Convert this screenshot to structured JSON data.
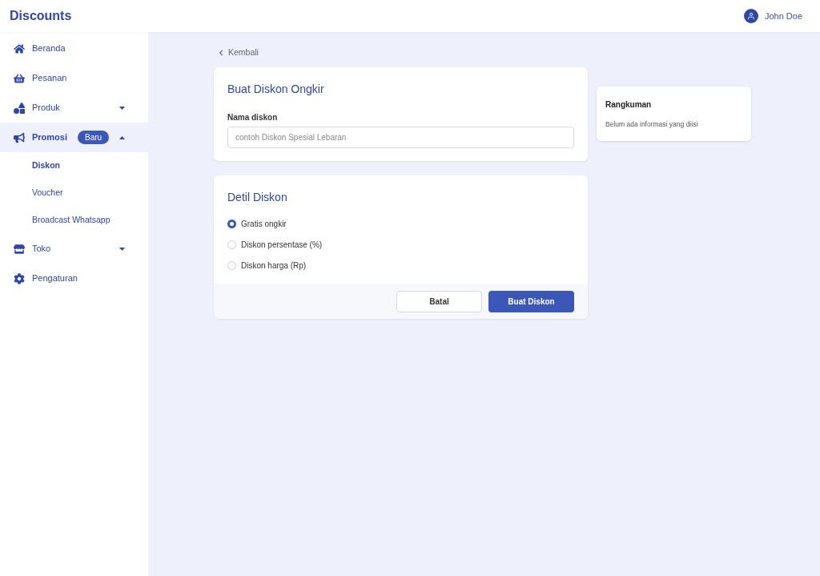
{
  "app": {
    "title": "Discounts"
  },
  "user": {
    "name": "John Doe"
  },
  "sidebar": {
    "items": [
      {
        "label": "Beranda",
        "selected": false
      },
      {
        "label": "Pesanan",
        "selected": false
      },
      {
        "label": "Produk",
        "selected": false,
        "expanded": false
      },
      {
        "label": "Promosi",
        "badge": "Baru",
        "selected": true,
        "expanded": true,
        "children": [
          {
            "label": "Diskon",
            "selected": true
          },
          {
            "label": "Voucher",
            "selected": false
          },
          {
            "label": "Broadcast Whatsapp",
            "selected": false
          }
        ]
      },
      {
        "label": "Toko",
        "selected": false,
        "expanded": false
      },
      {
        "label": "Pengaturan",
        "selected": false
      }
    ]
  },
  "back_link": "Kembali",
  "form_card": {
    "title": "Buat Diskon Ongkir",
    "field_label": "Nama diskon",
    "placeholder": "contoh Diskon Spesial Lebaran"
  },
  "detail_card": {
    "title": "Detil Diskon",
    "options": [
      {
        "label": "Gratis ongkir",
        "selected": true
      },
      {
        "label": "Diskon persentase (%)",
        "selected": false
      },
      {
        "label": "Diskon harga (Rp)",
        "selected": false
      }
    ],
    "buttons": [
      {
        "label": "Batal",
        "kind": "secondary"
      },
      {
        "label": "Buat Diskon",
        "kind": "primary"
      }
    ]
  },
  "summary": {
    "title": "Rangkuman",
    "text": "Belum ada informasi yang diisi"
  }
}
